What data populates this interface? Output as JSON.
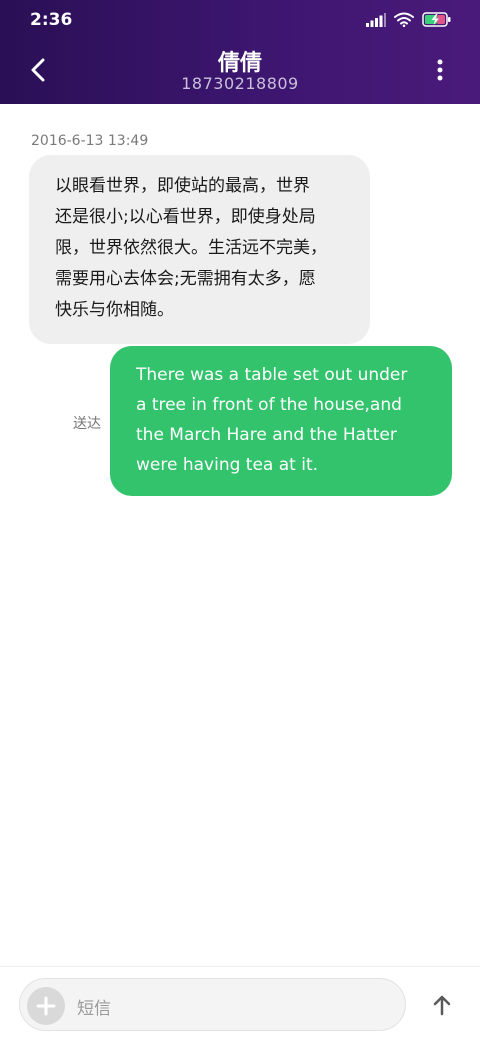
{
  "status_bar": {
    "time": "2:36",
    "icons": [
      "signal-icon",
      "wifi-icon",
      "battery-charging-icon"
    ]
  },
  "header": {
    "contact_name": "倩倩",
    "contact_number": "18730218809",
    "back_icon": "chevron-left-icon",
    "more_icon": "more-vertical-icon"
  },
  "conversation": {
    "timestamp": "2016-6-13 13:49",
    "incoming": {
      "lines": [
        "以眼看世界，即使站的最高，世界",
        "还是很小;以心看世界，即使身处局",
        "限，世界依然很大。生活远不完美，",
        "需要用心去体会;无需拥有太多，愿",
        "快乐与你相随。"
      ]
    },
    "outgoing": {
      "lines": [
        "There was a table set out under",
        "a tree in front of the house,and",
        "the March Hare and the Hatter",
        "were having tea at it."
      ],
      "status": "送达"
    }
  },
  "compose": {
    "placeholder": "短信",
    "attach_icon": "plus-icon",
    "send_icon": "arrow-up-icon"
  },
  "colors": {
    "header_gradient_start": "#2a0f55",
    "header_gradient_end": "#4a1a7a",
    "outgoing_bubble": "#32c36c",
    "incoming_bubble": "#efefef",
    "battery_fill": "#39d27a",
    "battery_tip": "#e2558a"
  }
}
